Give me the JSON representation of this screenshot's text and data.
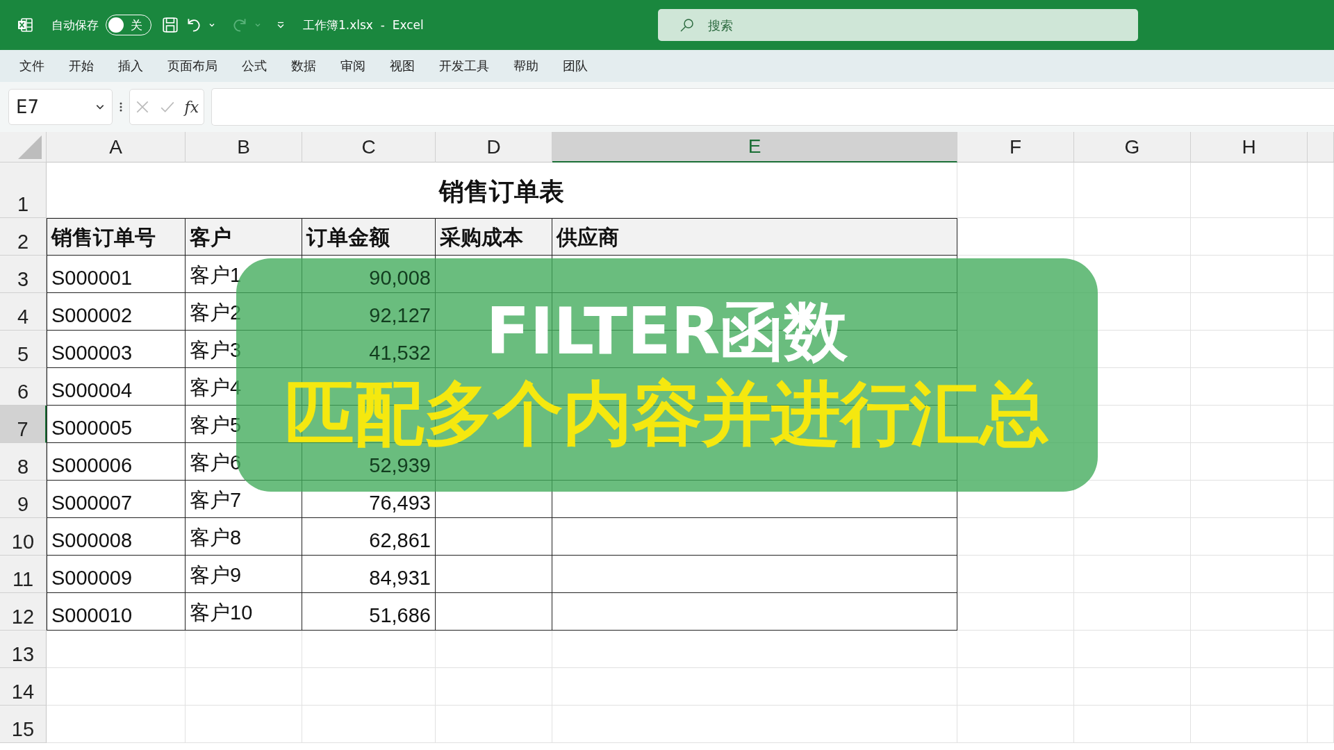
{
  "title_bar": {
    "autosave_label": "自动保存",
    "autosave_toggle": {
      "on": false,
      "label": "关"
    },
    "redo_disabled": true,
    "title": "工作簿1.xlsx  -  Excel",
    "search": {
      "placeholder": "搜索"
    }
  },
  "menu": [
    "文件",
    "开始",
    "插入",
    "页面布局",
    "公式",
    "数据",
    "审阅",
    "视图",
    "开发工具",
    "帮助",
    "团队"
  ],
  "formula_bar": {
    "name_box": "E7",
    "function_button": "fx"
  },
  "columns": [
    {
      "label": "A",
      "selected": false
    },
    {
      "label": "B",
      "selected": false
    },
    {
      "label": "C",
      "selected": false
    },
    {
      "label": "D",
      "selected": false
    },
    {
      "label": "E",
      "selected": true
    },
    {
      "label": "F",
      "selected": false
    },
    {
      "label": "G",
      "selected": false
    },
    {
      "label": "H",
      "selected": false
    }
  ],
  "row_headers": [
    {
      "label": "1",
      "selected": false
    },
    {
      "label": "2",
      "selected": false
    },
    {
      "label": "3",
      "selected": false
    },
    {
      "label": "4",
      "selected": false
    },
    {
      "label": "5",
      "selected": false
    },
    {
      "label": "6",
      "selected": false
    },
    {
      "label": "7",
      "selected": true
    },
    {
      "label": "8",
      "selected": false
    },
    {
      "label": "9",
      "selected": false
    },
    {
      "label": "10",
      "selected": false
    },
    {
      "label": "11",
      "selected": false
    },
    {
      "label": "12",
      "selected": false
    },
    {
      "label": "13",
      "selected": false
    },
    {
      "label": "14",
      "selected": false
    },
    {
      "label": "15",
      "selected": false
    }
  ],
  "table": {
    "title": "销售订单表",
    "headers": [
      "销售订单号",
      "客户",
      "订单金额",
      "采购成本",
      "供应商"
    ],
    "rows": [
      {
        "order_no": "S000001",
        "customer": "客户1",
        "amount": "90,008"
      },
      {
        "order_no": "S000002",
        "customer": "客户2",
        "amount": "92,127"
      },
      {
        "order_no": "S000003",
        "customer": "客户3",
        "amount": "41,532"
      },
      {
        "order_no": "S000004",
        "customer": "客户4"
      },
      {
        "order_no": "S000005",
        "customer": "客户5"
      },
      {
        "order_no": "S000006",
        "customer": "客户6",
        "amount": "52,939"
      },
      {
        "order_no": "S000007",
        "customer": "客户7",
        "amount": "76,493"
      },
      {
        "order_no": "S000008",
        "customer": "客户8",
        "amount": "62,861"
      },
      {
        "order_no": "S000009",
        "customer": "客户9",
        "amount": "84,931"
      },
      {
        "order_no": "S000010",
        "customer": "客户10",
        "amount": "51,686"
      }
    ]
  },
  "banner": {
    "title": "FILTER函数",
    "subtitle": "匹配多个内容并进行汇总"
  }
}
